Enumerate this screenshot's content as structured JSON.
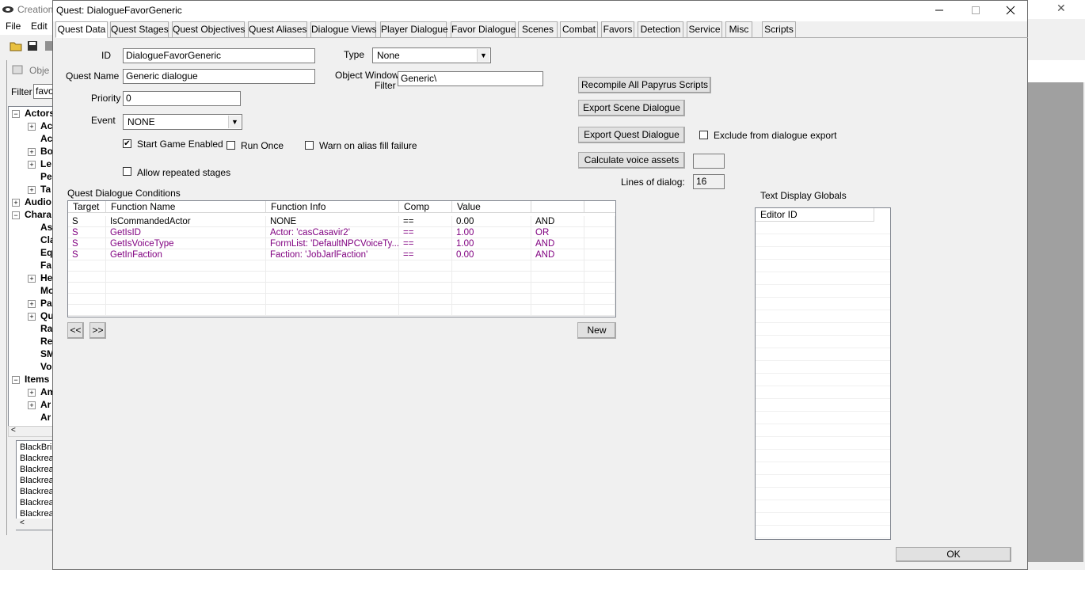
{
  "app": {
    "title": "Creation",
    "menu": [
      "File",
      "Edit"
    ],
    "close": "✕",
    "object_window": {
      "title": "Obje",
      "filter_label": "Filter",
      "filter_value": "favo",
      "tree": [
        {
          "label": "Actors",
          "bold": true,
          "toggle": "−"
        },
        {
          "label": "Ac",
          "bold": true,
          "toggle": "+"
        },
        {
          "label": "Ac",
          "bold": true,
          "toggle": ""
        },
        {
          "label": "Bo",
          "bold": true,
          "toggle": "+"
        },
        {
          "label": "Le",
          "bold": true,
          "toggle": "+"
        },
        {
          "label": "Pe",
          "bold": true,
          "toggle": ""
        },
        {
          "label": "Ta",
          "bold": true,
          "toggle": "+"
        },
        {
          "label": "Audio",
          "bold": true,
          "toggle": "+"
        },
        {
          "label": "Chara",
          "bold": true,
          "toggle": "−"
        },
        {
          "label": "As",
          "bold": true,
          "toggle": ""
        },
        {
          "label": "Cla",
          "bold": true,
          "toggle": ""
        },
        {
          "label": "Eq",
          "bold": true,
          "toggle": ""
        },
        {
          "label": "Fa",
          "bold": true,
          "toggle": ""
        },
        {
          "label": "He",
          "bold": true,
          "toggle": "+"
        },
        {
          "label": "Mo",
          "bold": true,
          "toggle": ""
        },
        {
          "label": "Pa",
          "bold": true,
          "toggle": "+"
        },
        {
          "label": "Qu",
          "bold": true,
          "toggle": "+"
        },
        {
          "label": "Ra",
          "bold": true,
          "toggle": ""
        },
        {
          "label": "Re",
          "bold": true,
          "toggle": ""
        },
        {
          "label": "SM",
          "bold": true,
          "toggle": ""
        },
        {
          "label": "Vo",
          "bold": true,
          "toggle": ""
        },
        {
          "label": "Items",
          "bold": true,
          "toggle": "−"
        },
        {
          "label": "Am",
          "bold": true,
          "toggle": "+"
        },
        {
          "label": "Ar",
          "bold": true,
          "toggle": "+"
        },
        {
          "label": "Ar",
          "bold": true,
          "toggle": ""
        }
      ],
      "list": [
        "BlackBri",
        "Blackrea",
        "Blackrea",
        "Blackrea",
        "Blackrea",
        "Blackrea",
        "Blackrea"
      ]
    }
  },
  "dialog": {
    "title": "Quest: DialogueFavorGeneric",
    "tabs": [
      "Quest Data",
      "Quest Stages",
      "Quest Objectives",
      "Quest Aliases",
      "Dialogue Views",
      "Player Dialogue",
      "Favor Dialogue",
      "Scenes",
      "Combat",
      "Favors",
      "Detection",
      "Service",
      "Misc",
      "Scripts"
    ],
    "active_tab": "Quest Data",
    "fields": {
      "id_label": "ID",
      "id_value": "DialogueFavorGeneric",
      "type_label": "Type",
      "type_value": "None",
      "quest_name_label": "Quest Name",
      "quest_name_value": "Generic dialogue",
      "owf_label_1": "Object Window",
      "owf_label_2": "Filter",
      "owf_value": "Generic\\",
      "priority_label": "Priority",
      "priority_value": "0",
      "event_label": "Event",
      "event_value": "NONE"
    },
    "checkboxes": {
      "start_game_enabled": {
        "label": "Start Game Enabled",
        "checked": true
      },
      "run_once": {
        "label": "Run Once",
        "checked": false
      },
      "warn_alias": {
        "label": "Warn on alias fill failure",
        "checked": false
      },
      "allow_repeated": {
        "label": "Allow repeated stages",
        "checked": false
      },
      "exclude_export": {
        "label": "Exclude from dialogue export",
        "checked": false
      }
    },
    "buttons": {
      "recompile": "Recompile All Papyrus Scripts",
      "export_scene": "Export Scene Dialogue",
      "export_quest": "Export Quest Dialogue",
      "calc_voice": "Calculate voice assets",
      "prev": "<<",
      "next": ">>",
      "new": "New",
      "ok": "OK"
    },
    "calc_voice_value": "",
    "lines_of_dialog_label": "Lines of dialog:",
    "lines_of_dialog_value": "16",
    "conditions": {
      "label": "Quest Dialogue Conditions",
      "columns": [
        "Target",
        "Function Name",
        "Function Info",
        "Comp",
        "Value",
        ""
      ],
      "rows": [
        {
          "target": "S",
          "function": "IsCommandedActor",
          "info": "NONE",
          "comp": "==",
          "value": "0.00",
          "op": "AND",
          "color": "#000000"
        },
        {
          "target": "S",
          "function": "GetIsID",
          "info": "Actor: 'casCasavir2'",
          "comp": "==",
          "value": "1.00",
          "op": "OR",
          "color": "#800080"
        },
        {
          "target": "S",
          "function": "GetIsVoiceType",
          "info": "FormList: 'DefaultNPCVoiceTy...",
          "comp": "==",
          "value": "1.00",
          "op": "AND",
          "color": "#800080"
        },
        {
          "target": "S",
          "function": "GetInFaction",
          "info": "Faction: 'JobJarlFaction'",
          "comp": "==",
          "value": "0.00",
          "op": "AND",
          "color": "#800080"
        }
      ]
    },
    "globals": {
      "label": "Text Display Globals",
      "column": "Editor ID"
    }
  }
}
